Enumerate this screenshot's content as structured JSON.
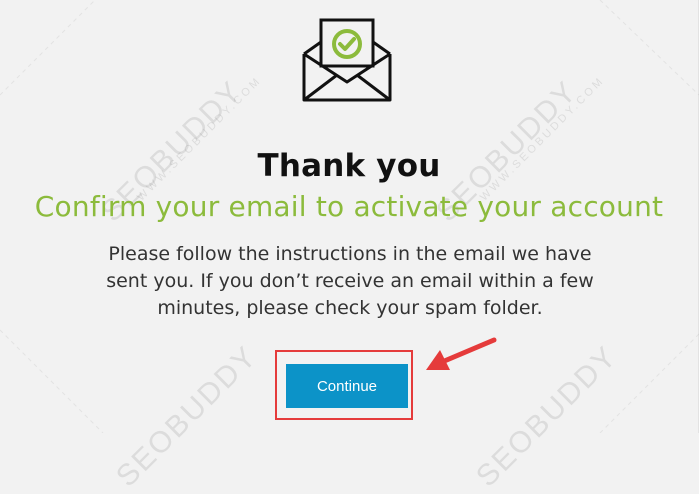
{
  "icon": {
    "name": "envelope-check-icon",
    "accent": "#8cbb3c"
  },
  "heading": {
    "title": "Thank you",
    "subtitle": "Confirm your email to activate your account"
  },
  "message": {
    "line1": "Please follow the instructions in the email we have",
    "line2": "sent you. If you don’t receive an email within a few",
    "line3": "minutes, please check your spam folder."
  },
  "actions": {
    "continue_label": "Continue"
  },
  "colors": {
    "background": "#f2f2f2",
    "title": "#111111",
    "subtitle": "#8cbb3c",
    "button": "#0c93c8",
    "annotation": "#e53b3b"
  },
  "watermark": {
    "brand": "SEOBUDDY",
    "site": "WWW.SEOBUDDY.COM"
  }
}
